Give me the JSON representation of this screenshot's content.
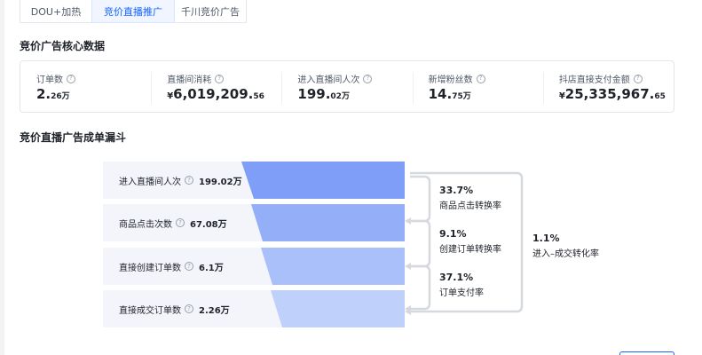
{
  "tabs": [
    {
      "label": "DOU+加热"
    },
    {
      "label": "竞价直播推广"
    },
    {
      "label": "千川竞价广告"
    }
  ],
  "core_data": {
    "title": "竞价广告核心数据",
    "metrics": [
      {
        "label": "订单数",
        "currency": "",
        "main": "2.",
        "small": "26万"
      },
      {
        "label": "直播间消耗",
        "currency": "¥",
        "main": "6,019,209.",
        "small": "56"
      },
      {
        "label": "进入直播间人次",
        "currency": "",
        "main": "199.",
        "small": "02万"
      },
      {
        "label": "新增粉丝数",
        "currency": "",
        "main": "14.",
        "small": "75万"
      },
      {
        "label": "抖店直接支付金额",
        "currency": "¥",
        "main": "25,335,967.",
        "small": "65"
      }
    ]
  },
  "funnel": {
    "title": "竞价直播广告成单漏斗",
    "stages": [
      {
        "label": "进入直播间人次",
        "value": "199.02万"
      },
      {
        "label": "商品点击次数",
        "value": "67.08万"
      },
      {
        "label": "直接创建订单数",
        "value": "6.1万"
      },
      {
        "label": "直接成交订单数",
        "value": "2.26万"
      }
    ],
    "conversions": [
      {
        "pct": "33.7%",
        "desc": "商品点击转换率"
      },
      {
        "pct": "9.1%",
        "desc": "创建订单转换率"
      },
      {
        "pct": "37.1%",
        "desc": "订单支付率"
      }
    ],
    "overall": {
      "pct": "1.1%",
      "desc": "进入–成交转化率"
    },
    "colors": [
      "#7f9ef7",
      "#94aff8",
      "#a9c0fa",
      "#bfd0fb"
    ]
  }
}
